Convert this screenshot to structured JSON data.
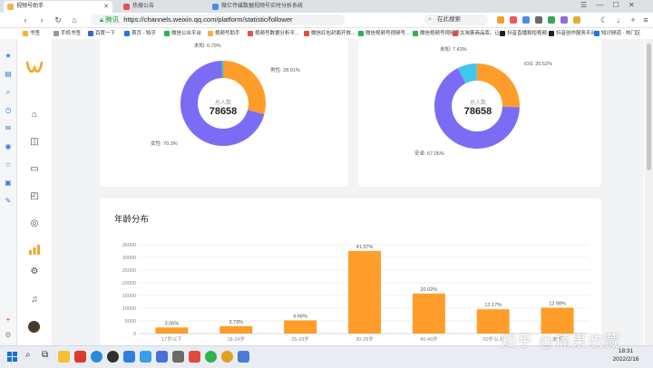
{
  "browser": {
    "tabs": [
      {
        "label": "视频号助手",
        "active": true
      },
      {
        "label": "热搜公告",
        "active": false
      },
      {
        "label": "微亿传媒数据视频号实时分析系统",
        "active": false
      }
    ],
    "secure_label": "腾讯",
    "url": "https://channels.weixin.qq.com/platform/statistic/follower",
    "search_placeholder": "在此搜索",
    "bookmarks": [
      "书签",
      "手机书签",
      "百度一下",
      "首页 - 知乎",
      "微信公众平台",
      "视频号助手",
      "视频号数据分析平...",
      "微信红包封面开放...",
      "微信视频号视频号...",
      "微信视频号视频号...",
      "大淘客商品库、让...",
      "抖音直播和短视频...",
      "抖音创作服务平台",
      "知识频道 · 热门区"
    ]
  },
  "gender_donut": {
    "center_label": "总人数",
    "total": "78658",
    "segments": [
      {
        "label": "男性: 28.91%",
        "value": 28.91,
        "color": "#ff9d2b"
      },
      {
        "label": "女性: 70.3%",
        "value": 70.3,
        "color": "#7b6cf6"
      },
      {
        "label": "未知: 0.79%",
        "value": 0.79,
        "color": "#43c98c"
      }
    ]
  },
  "device_donut": {
    "center_label": "总人数",
    "total": "78658",
    "segments": [
      {
        "label": "iOS: 25.52%",
        "value": 25.52,
        "color": "#ff9d2b"
      },
      {
        "label": "安卓: 67.05%",
        "value": 67.05,
        "color": "#7b6cf6"
      },
      {
        "label": "未知: 7.43%",
        "value": 7.43,
        "color": "#3fc7ee"
      }
    ]
  },
  "age_section": {
    "title": "年龄分布"
  },
  "chart_data": {
    "type": "bar",
    "title": "年龄分布",
    "categories": [
      "17岁以下",
      "18-24岁",
      "25-29岁",
      "30-39岁",
      "40-49岁",
      "50岁以上",
      "未知"
    ],
    "values": [
      2400,
      2930,
      5200,
      32550,
      15750,
      9570,
      10210
    ],
    "data_labels": [
      "3.06%",
      "3.73%",
      "6.66%",
      "41.37%",
      "20.02%",
      "12.17%",
      "12.98%"
    ],
    "yticks": [
      "35000",
      "30000",
      "25000",
      "20000",
      "15000",
      "10000",
      "5000",
      "0"
    ],
    "ylim": [
      0,
      35000
    ],
    "grid": true,
    "color": "#ff9d2b"
  },
  "taskbar": {
    "time": "18:31",
    "date": "2022/2/16"
  },
  "watermark": "知乎 @楠果收藏"
}
